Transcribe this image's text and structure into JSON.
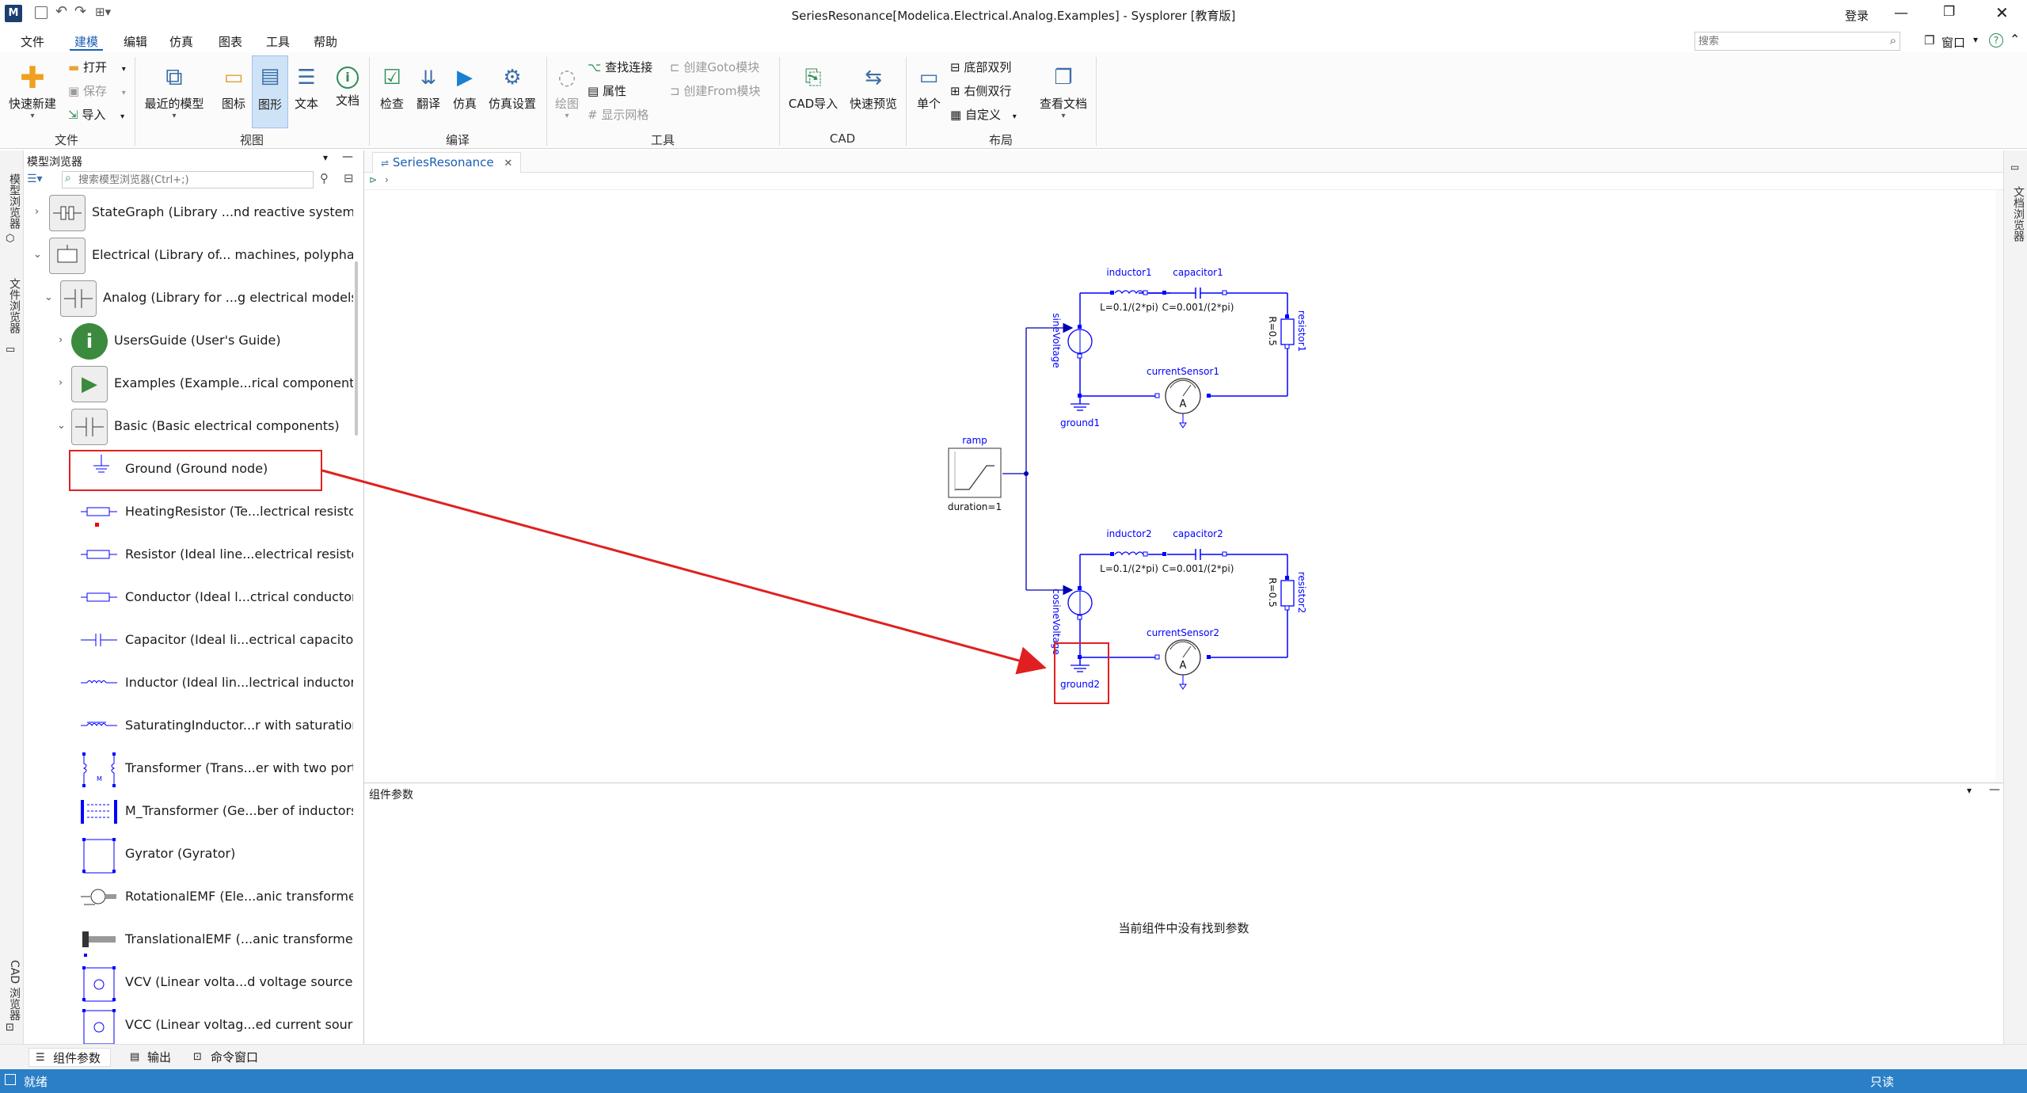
{
  "window": {
    "title": "SeriesResonance[Modelica.Electrical.Analog.Examples] - Sysplorer [教育版]",
    "login": "登录"
  },
  "menu": {
    "items": [
      "文件",
      "建模",
      "编辑",
      "仿真",
      "图表",
      "工具",
      "帮助"
    ],
    "active": "建模",
    "search_placeholder": "搜索",
    "window_label": "窗口"
  },
  "ribbon": {
    "file_group": {
      "label": "文件",
      "new": "快速新建",
      "open": "打开",
      "save": "保存",
      "import": "导入"
    },
    "view_group": {
      "label": "视图",
      "recent": "最近的模型",
      "icon": "图标",
      "diagram": "图形",
      "text": "文本",
      "doc": "文档"
    },
    "compile_group": {
      "label": "编译",
      "check": "检查",
      "translate": "翻译",
      "simulate": "仿真",
      "sim_settings": "仿真设置"
    },
    "tools_group": {
      "label": "工具",
      "draw": "绘图",
      "find_conn": "查找连接",
      "props": "属性",
      "grid": "显示网格",
      "goto": "创建Goto模块",
      "from": "创建From模块"
    },
    "cad_group": {
      "label": "CAD",
      "import": "CAD导入",
      "preview": "快速预览"
    },
    "layout_group": {
      "label": "布局",
      "single": "单个",
      "bottom_dual": "底部双列",
      "right_dual": "右侧双行",
      "custom": "自定义",
      "view_doc": "查看文档"
    }
  },
  "left_tabs": [
    "模型浏览器",
    "文件浏览器",
    "CAD 浏览器"
  ],
  "right_tabs": [
    "文档浏览器"
  ],
  "browser": {
    "title": "模型浏览器",
    "search_placeholder": "搜索模型浏览器(Ctrl+;)",
    "items": [
      {
        "label": "StateGraph (Library ...nd reactive systems)",
        "expanded": false
      },
      {
        "label": "Electrical (Library of... machines, polyphase))",
        "expanded": true
      },
      {
        "label": "Analog (Library for ...g electrical models)",
        "expanded": true
      },
      {
        "label": "UsersGuide (User's Guide)",
        "expanded": false
      },
      {
        "label": "Examples (Example...rical components)",
        "expanded": false
      },
      {
        "label": "Basic (Basic electrical components)",
        "expanded": true
      },
      {
        "label": "Ground (Ground node)"
      },
      {
        "label": "HeatingResistor (Te...lectrical resistor)"
      },
      {
        "label": "Resistor (Ideal line...electrical resistor)"
      },
      {
        "label": "Conductor (Ideal l...ctrical conductor)"
      },
      {
        "label": "Capacitor (Ideal li...ectrical capacitor)"
      },
      {
        "label": "Inductor (Ideal lin...lectrical inductor)"
      },
      {
        "label": "SaturatingInductor...r with saturation)"
      },
      {
        "label": "Transformer (Trans...er with two ports)"
      },
      {
        "label": "M_Transformer (Ge...ber of inductors)"
      },
      {
        "label": "Gyrator (Gyrator)"
      },
      {
        "label": "RotationalEMF (Ele...anic transformer))"
      },
      {
        "label": "TranslationalEMF (...anic transformer))"
      },
      {
        "label": "VCV (Linear volta...d voltage source)"
      },
      {
        "label": "VCC (Linear voltag...ed current source)"
      }
    ]
  },
  "editor": {
    "tab": "SeriesResonance",
    "diagram": {
      "inductor1": "inductor1",
      "inductor1_param": "L=0.1/(2*pi)",
      "capacitor1": "capacitor1",
      "capacitor1_param": "C=0.001/(2*pi)",
      "resistor1": "resistor1",
      "resistor1_param": "R=0.5",
      "sineVoltage": "sineVoltage",
      "currentSensor1": "currentSensor1",
      "ground1": "ground1",
      "ramp": "ramp",
      "ramp_param": "duration=1",
      "inductor2": "inductor2",
      "inductor2_param": "L=0.1/(2*pi)",
      "capacitor2": "capacitor2",
      "capacitor2_param": "C=0.001/(2*pi)",
      "resistor2": "resistor2",
      "resistor2_param": "R=0.5",
      "cosineVoltage": "cosineVoltage",
      "currentSensor2": "currentSensor2",
      "ground2": "ground2",
      "ammeter_symbol": "A"
    }
  },
  "params_panel": {
    "title": "组件参数",
    "empty_message": "当前组件中没有找到参数"
  },
  "bottom_tabs": [
    "组件参数",
    "输出",
    "命令窗口"
  ],
  "status": {
    "left": "就绪",
    "right": "只读"
  },
  "colors": {
    "accent": "#1a5fb4",
    "diagram_blue": "#0000ff",
    "highlight_red": "#e02020",
    "statusbar": "#2a7fc7"
  }
}
